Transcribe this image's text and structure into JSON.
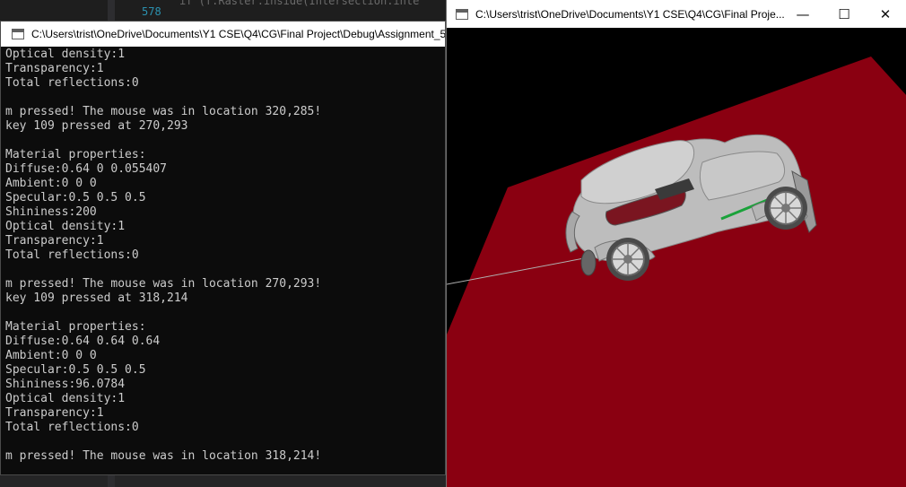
{
  "ide": {
    "line_number": "578",
    "code_snippet": "if (f.Raster.inside(Intersection.inte"
  },
  "console": {
    "title": "C:\\Users\\trist\\OneDrive\\Documents\\Y1 CSE\\Q4\\CG\\Final Project\\Debug\\Assignment_5",
    "lines": [
      "Optical density:1",
      "Transparency:1",
      "Total reflections:0",
      "",
      "m pressed! The mouse was in location 320,285!",
      "key 109 pressed at 270,293",
      "",
      "Material properties:",
      "Diffuse:0.64 0 0.055407",
      "Ambient:0 0 0",
      "Specular:0.5 0.5 0.5",
      "Shininess:200",
      "Optical density:1",
      "Transparency:1",
      "Total reflections:0",
      "",
      "m pressed! The mouse was in location 270,293!",
      "key 109 pressed at 318,214",
      "",
      "Material properties:",
      "Diffuse:0.64 0.64 0.64",
      "Ambient:0 0 0",
      "Specular:0.5 0.5 0.5",
      "Shininess:96.0784",
      "Optical density:1",
      "Transparency:1",
      "Total reflections:0",
      "",
      "m pressed! The mouse was in location 318,214!"
    ]
  },
  "viewer": {
    "title": "C:\\Users\\trist\\OneDrive\\Documents\\Y1 CSE\\Q4\\CG\\Final Proje...",
    "controls": {
      "minimize": "—",
      "maximize": "☐",
      "close": "✕"
    },
    "colors": {
      "background": "#000000",
      "ground": "#8a0011",
      "car": "#c4c4c4",
      "car_accent": "#1aa23a"
    },
    "icons": [
      "app-window-icon",
      "car-model",
      "ground-plane",
      "ray-line"
    ]
  }
}
